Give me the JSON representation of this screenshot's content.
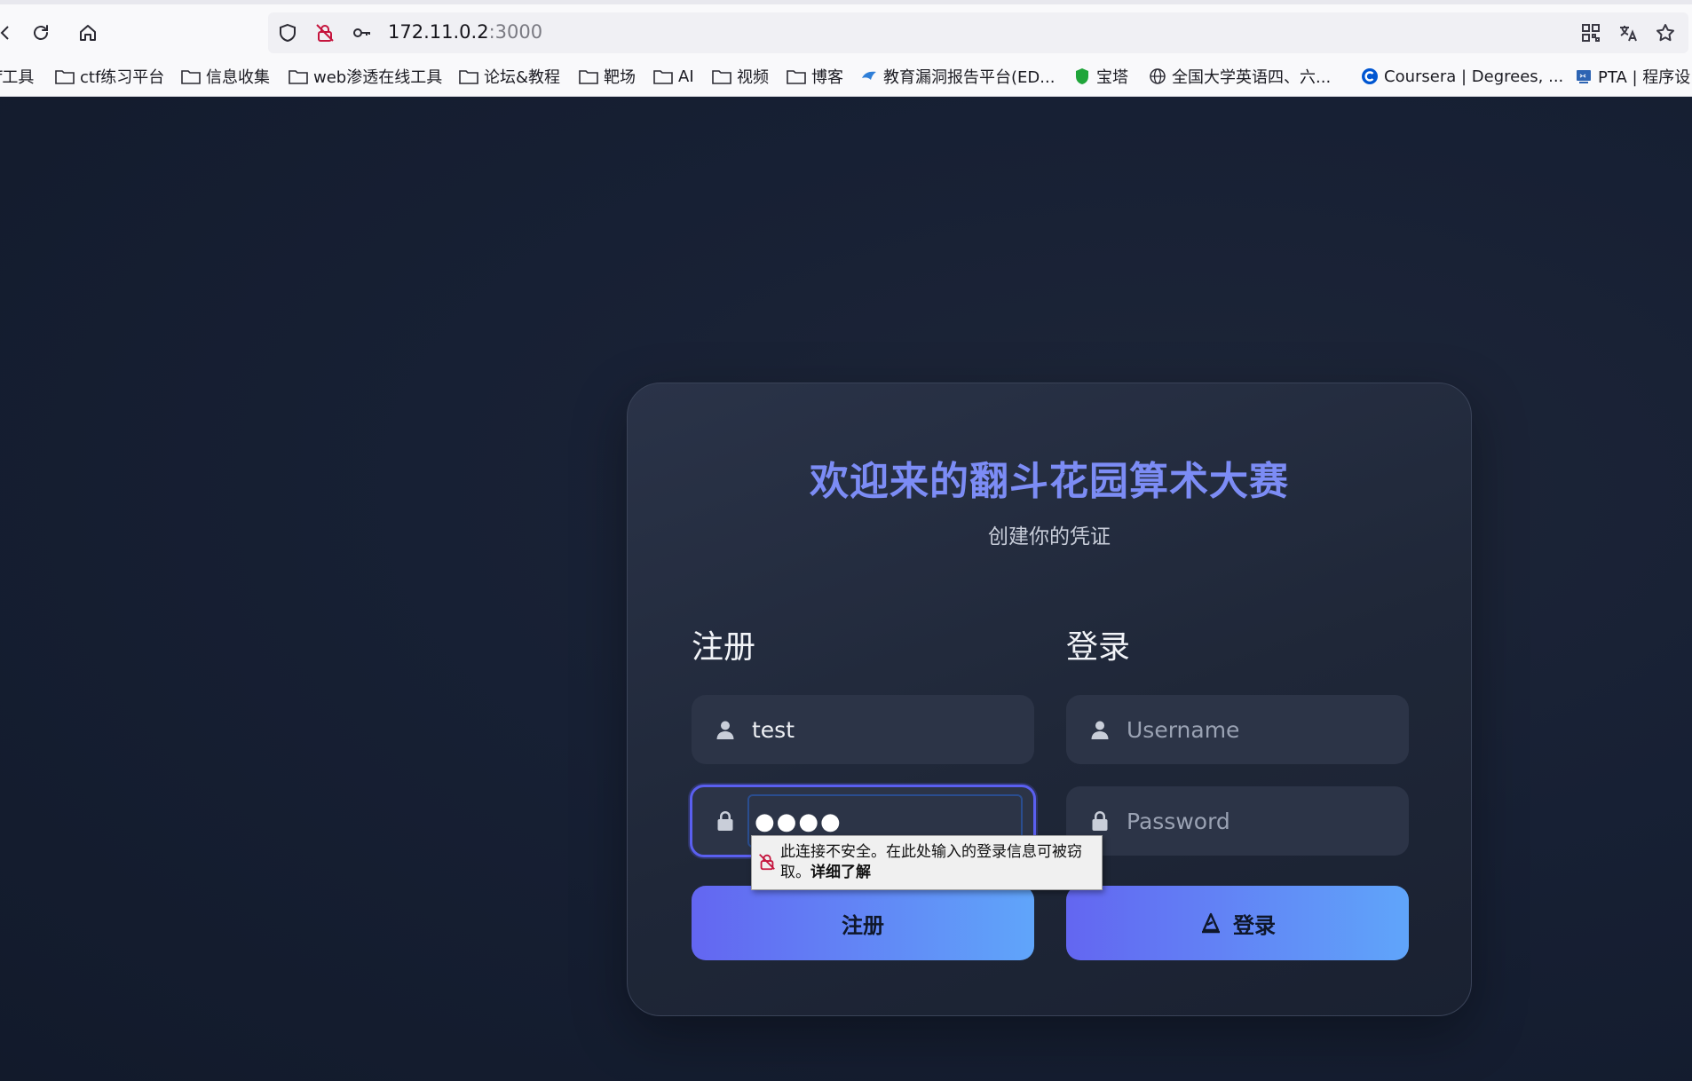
{
  "browser": {
    "url_host": "172.11.0.2",
    "url_port": ":3000"
  },
  "bookmarks": [
    {
      "label": "f工具",
      "icon": "folder-icon"
    },
    {
      "label": "ctf练习平台",
      "icon": "folder-icon"
    },
    {
      "label": "信息收集",
      "icon": "folder-icon"
    },
    {
      "label": "web渗透在线工具",
      "icon": "folder-icon"
    },
    {
      "label": "论坛&教程",
      "icon": "folder-icon"
    },
    {
      "label": "靶场",
      "icon": "folder-icon"
    },
    {
      "label": "AI",
      "icon": "folder-icon"
    },
    {
      "label": "视频",
      "icon": "folder-icon"
    },
    {
      "label": "博客",
      "icon": "folder-icon"
    },
    {
      "label": "教育漏洞报告平台(ED...",
      "icon": "edu-src-icon"
    },
    {
      "label": "宝塔",
      "icon": "baota-icon"
    },
    {
      "label": "全国大学英语四、六...",
      "icon": "globe-icon"
    },
    {
      "label": "Coursera | Degrees, ...",
      "icon": "coursera-icon"
    },
    {
      "label": "PTA | 程序设",
      "icon": "pta-icon"
    }
  ],
  "card": {
    "title": "欢迎来的翻斗花园算术大赛",
    "subtitle": "创建你的凭证"
  },
  "register": {
    "heading": "注册",
    "username_value": "test",
    "password_mask": "●●●●",
    "button_label": "注册"
  },
  "login": {
    "heading": "登录",
    "username_placeholder": "Username",
    "password_placeholder": "Password",
    "button_label": "登录"
  },
  "security_tooltip": {
    "text": "此连接不安全。在此处输入的登录信息可被窃取。",
    "link": "详细了解"
  },
  "colors": {
    "accent_title": "#7c8cf5",
    "button_gradient_start": "#6366f1",
    "button_gradient_end": "#60a5fa",
    "page_background": "#141c2e"
  }
}
